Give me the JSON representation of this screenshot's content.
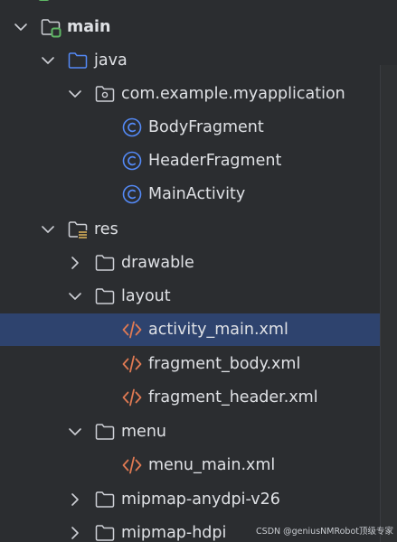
{
  "tree": {
    "main": "main",
    "java": "java",
    "package": "com.example.myapplication",
    "body_fragment": "BodyFragment",
    "header_fragment": "HeaderFragment",
    "main_activity": "MainActivity",
    "res": "res",
    "drawable": "drawable",
    "layout": "layout",
    "activity_main": "activity_main.xml",
    "fragment_body": "fragment_body.xml",
    "fragment_header": "fragment_header.xml",
    "menu": "menu",
    "menu_main": "menu_main.xml",
    "mipmap_anydpi": "mipmap-anydpi-v26",
    "mipmap_hdpi": "mipmap-hdpi"
  },
  "watermark": "CSDN @geniusNMRobot顶级专家",
  "colors": {
    "background": "#2b2d30",
    "selection": "#2e436e",
    "text": "#dfe1e5",
    "folder_stroke": "#ced0d6",
    "source_folder": "#548af7",
    "class_icon": "#548af7",
    "xml_icon": "#e07a53",
    "module_badge": "#5fb865"
  }
}
